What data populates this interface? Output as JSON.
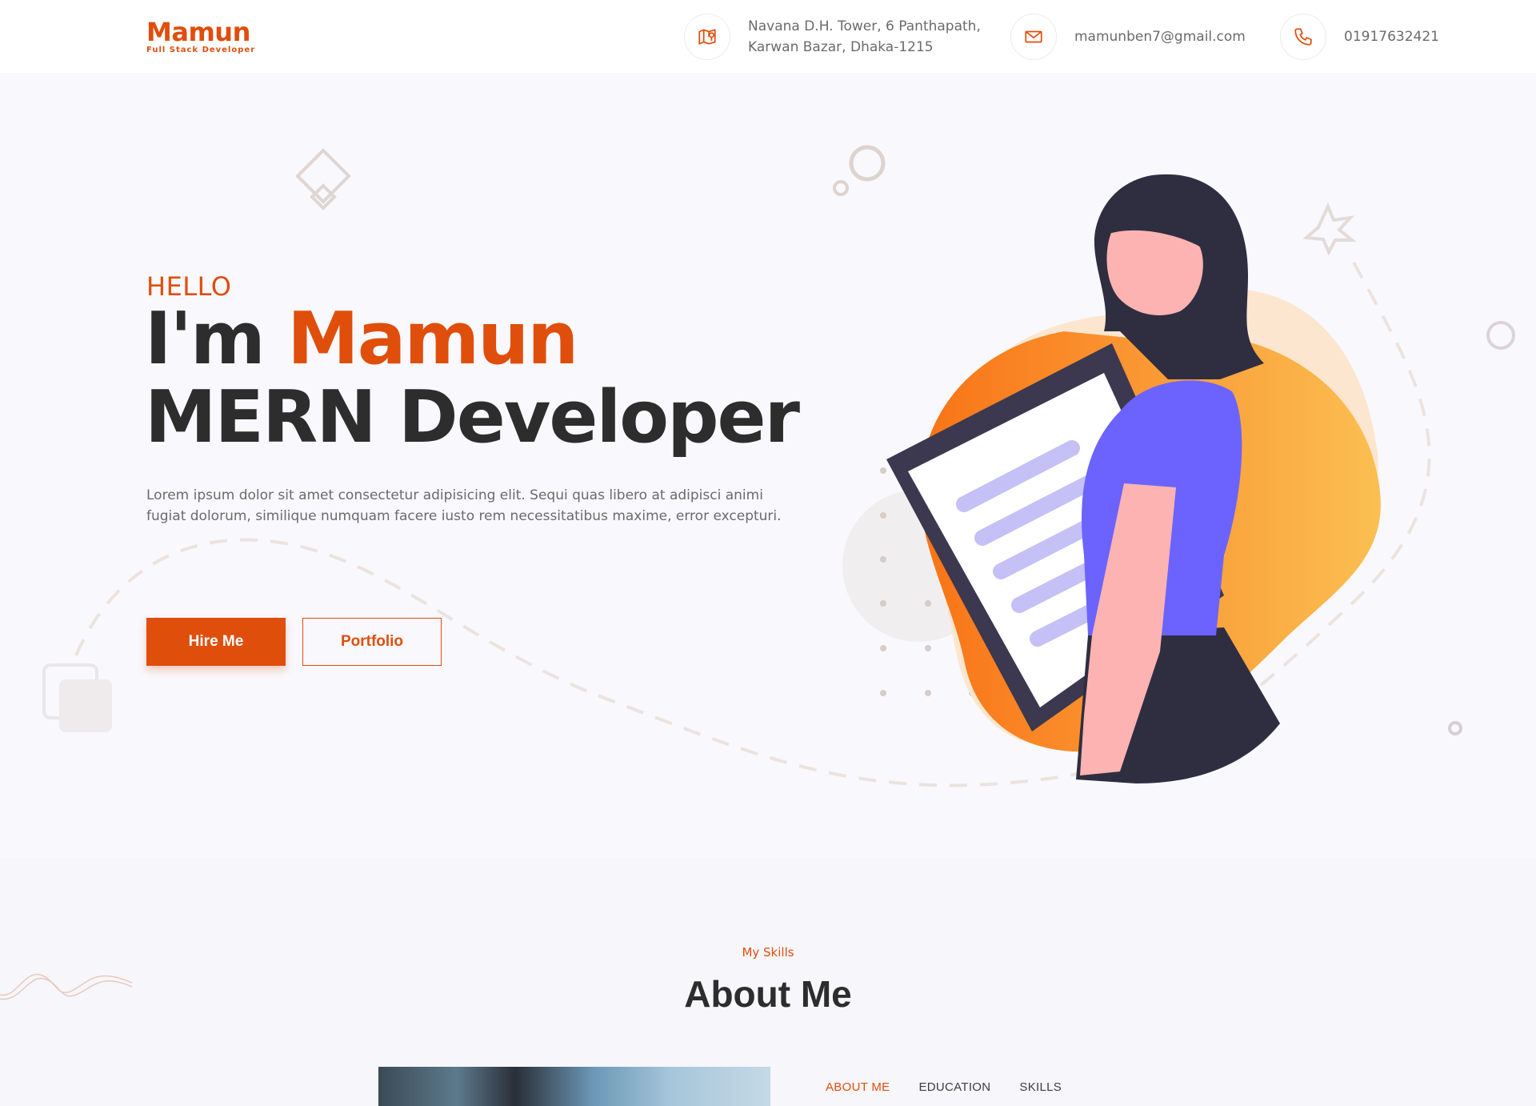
{
  "brand": {
    "name": "Mamun",
    "tagline": "Full Stack Developer",
    "accent_color": "#e04e0c"
  },
  "contacts": {
    "address_line1": "Navana D.H. Tower, 6 Panthapath,",
    "address_line2": "Karwan Bazar, Dhaka-1215",
    "address_icon": "map-icon",
    "email": "mamunben7@gmail.com",
    "email_icon": "mail-icon",
    "phone": "01917632421",
    "phone_icon": "phone-icon"
  },
  "hero": {
    "greeting": "HELLO",
    "title_prefix": "I'm ",
    "title_name": "Mamun",
    "role": "MERN Developer",
    "intro": "Lorem ipsum dolor sit amet consectetur adipisicing elit. Sequi quas libero at adipisci animi fugiat dolorum, similique numquam facere iusto rem necessitatibus maxime, error excepturi.",
    "hire_label": "Hire Me",
    "portfolio_label": "Portfolio"
  },
  "skills": {
    "kicker": "My Skills",
    "title": "About Me",
    "tabs": [
      "ABOUT ME",
      "EDUCATION",
      "SKILLS"
    ],
    "active_tab": "ABOUT ME"
  }
}
